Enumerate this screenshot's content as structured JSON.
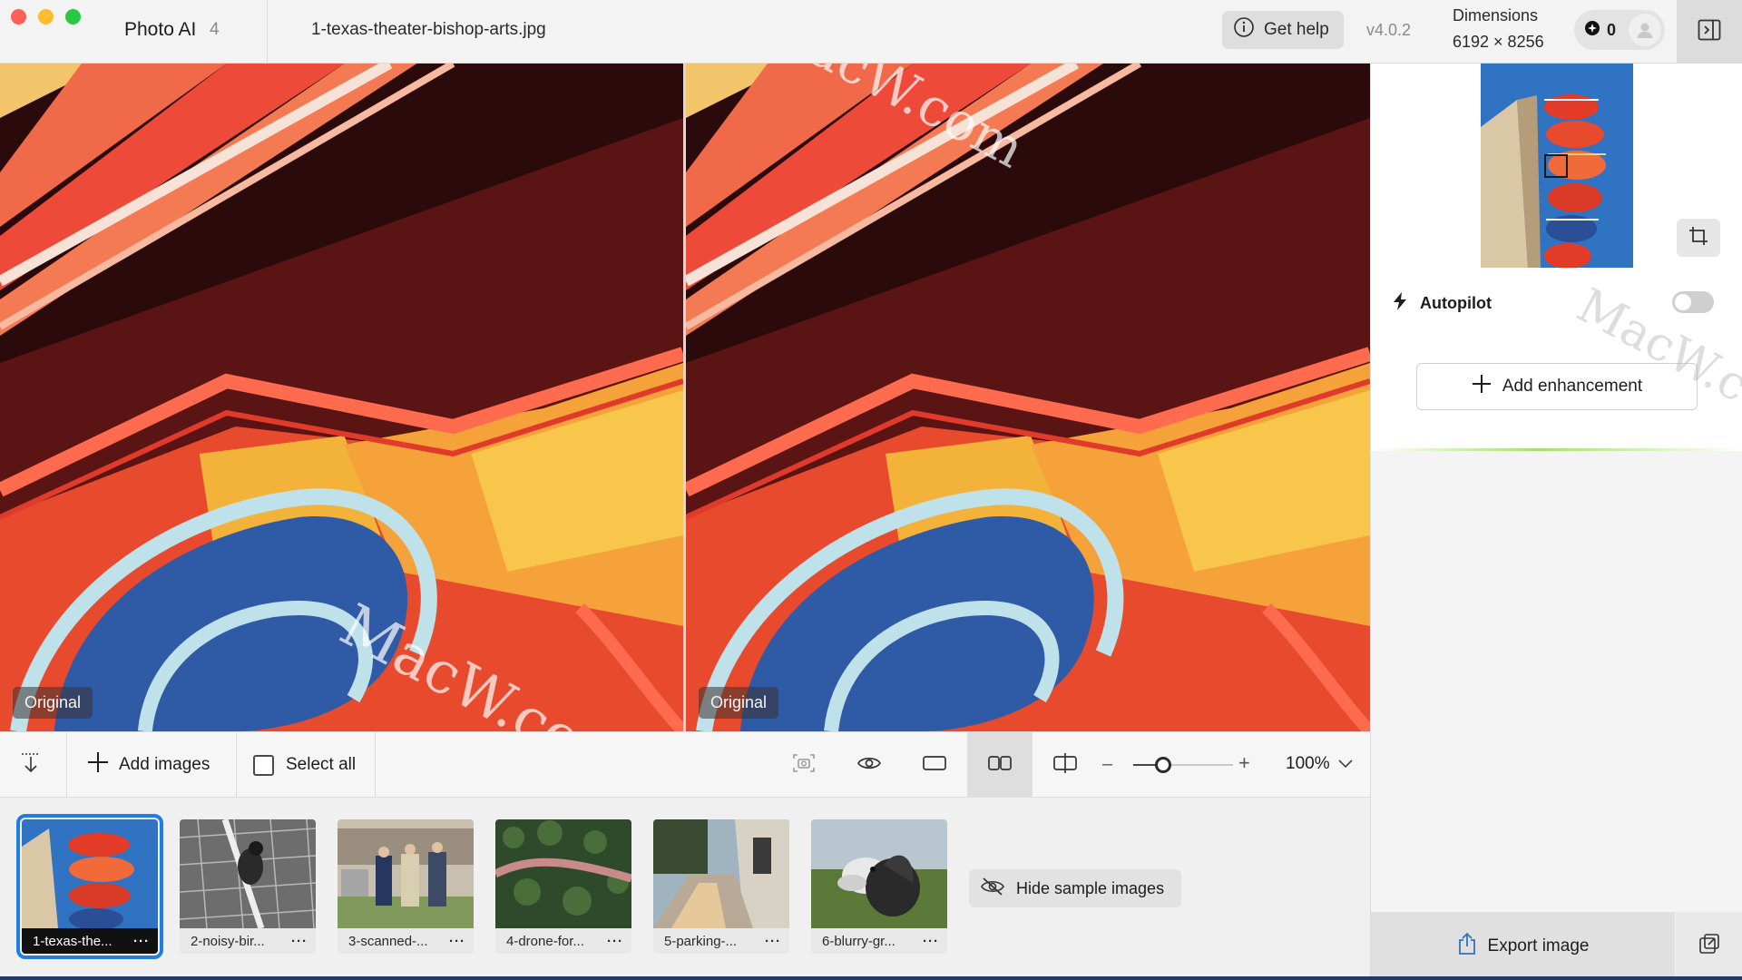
{
  "titlebar": {
    "app_name": "Photo AI",
    "app_version_badge": "4",
    "filename": "1-texas-theater-bishop-arts.jpg",
    "help_label": "Get help",
    "version": "v4.0.2",
    "dimensions_label": "Dimensions",
    "dimensions_value": "6192 × 8256",
    "credits": "0"
  },
  "viewer": {
    "left_tag": "Original",
    "right_tag": "Original",
    "watermark": "MacW.com"
  },
  "panel": {
    "autopilot_label": "Autopilot",
    "autopilot_on": false,
    "add_enhancement_label": "Add enhancement",
    "export_label": "Export image"
  },
  "toolbar": {
    "add_images_label": "Add images",
    "select_all_label": "Select all",
    "zoom_level": "100%",
    "zoom_fraction": 0.3,
    "active_view": "side-by-side"
  },
  "filmstrip": {
    "items": [
      {
        "label": "1-texas-the...",
        "active": true
      },
      {
        "label": "2-noisy-bir...",
        "active": false
      },
      {
        "label": "3-scanned-...",
        "active": false
      },
      {
        "label": "4-drone-for...",
        "active": false
      },
      {
        "label": "5-parking-...",
        "active": false
      },
      {
        "label": "6-blurry-gr...",
        "active": false
      }
    ],
    "more_label": "···",
    "hide_samples_label": "Hide sample images"
  },
  "colors": {
    "accent": "#1e7fe0",
    "toggle_off": "#cfcfcf",
    "traffic_red": "#fe5f57",
    "traffic_yellow": "#febc2e",
    "traffic_green": "#28c840"
  }
}
